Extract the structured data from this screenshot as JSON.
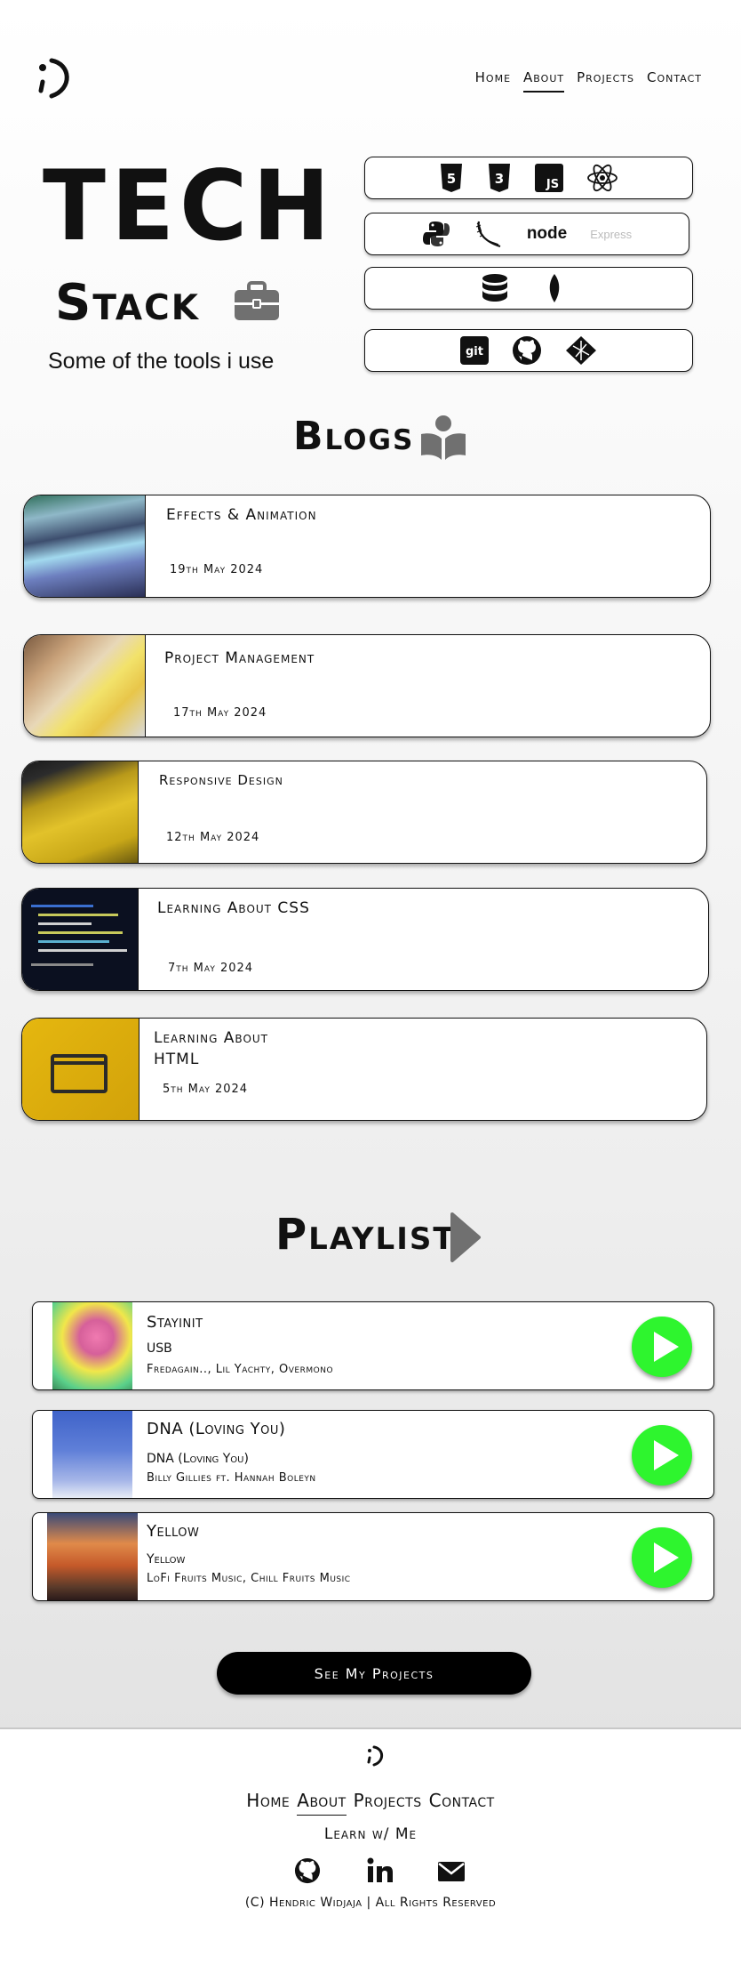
{
  "nav": {
    "items": [
      "Home",
      "About",
      "Projects",
      "Contact"
    ],
    "active": "About"
  },
  "logo_icon": "winking-face-logo-icon",
  "tech": {
    "title": "TECH",
    "subtitle": "Stack",
    "tagline": "Some of the tools i use",
    "rows": [
      [
        "html5-icon",
        "css3-icon",
        "javascript-icon",
        "react-icon"
      ],
      [
        "python-icon",
        "flask-icon",
        "nodejs-icon",
        "express-icon"
      ],
      [
        "database-icon",
        "mongodb-icon"
      ],
      [
        "git-icon",
        "github-icon",
        "netlify-icon"
      ]
    ],
    "node_label": "node",
    "express_label": "Express",
    "git_label": "git",
    "js_label": "JS"
  },
  "blogs": {
    "title": "Blogs",
    "items": [
      {
        "title": "Effects & Animation",
        "date": "19th May 2024"
      },
      {
        "title": "Project Management",
        "date": "17th May 2024"
      },
      {
        "title": "Responsive Design",
        "date": "12th May 2024"
      },
      {
        "title": "Learning About CSS",
        "date": "7th May 2024"
      },
      {
        "title": "Learning About HTML",
        "date": "5th May 2024"
      }
    ]
  },
  "playlist": {
    "title": "Playlist",
    "songs": [
      {
        "title": "Stayinit",
        "album": "USB",
        "artist": "Fredagain.., Lil Yachty, Overmono"
      },
      {
        "title": "DNA (Loving You)",
        "album": "DNA (Loving You)",
        "artist": "Billy Gillies ft. Hannah Boleyn"
      },
      {
        "title": "Yellow",
        "album": "Yellow",
        "artist": "LoFi Fruits Music, Chill Fruits Music"
      }
    ]
  },
  "cta": {
    "label": "See My Projects"
  },
  "footer": {
    "nav": [
      "Home",
      "About",
      "Projects",
      "Contact"
    ],
    "active": "About",
    "learn": "Learn w/ Me",
    "social": [
      "github-icon",
      "linkedin-icon",
      "mail-icon"
    ],
    "copyright": "(C) Hendric Widjaja | All Rights Reserved"
  },
  "colors": {
    "play_button": "#2ef52e",
    "text": "#111111",
    "cta_bg": "#000000"
  }
}
